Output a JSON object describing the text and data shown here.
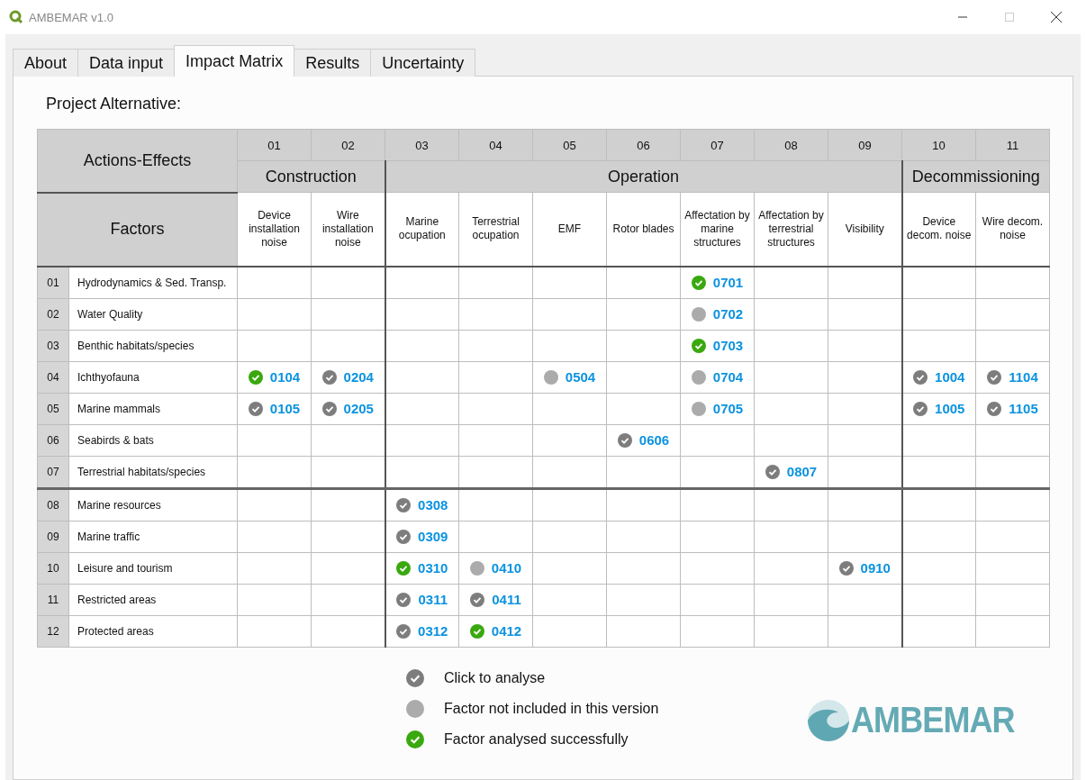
{
  "window": {
    "title": "AMBEMAR v1.0"
  },
  "tabs": [
    {
      "label": "About",
      "selected": false
    },
    {
      "label": "Data input",
      "selected": false
    },
    {
      "label": "Impact Matrix",
      "selected": true
    },
    {
      "label": "Results",
      "selected": false
    },
    {
      "label": "Uncertainty",
      "selected": false
    }
  ],
  "project_label": "Project Alternative:",
  "matrix": {
    "corner_top": "Actions-Effects",
    "corner_bottom": "Factors",
    "groups": [
      {
        "name": "Construction",
        "columns": [
          {
            "num": "01",
            "label": "Device installation noise"
          },
          {
            "num": "02",
            "label": "Wire installation noise"
          }
        ]
      },
      {
        "name": "Operation",
        "columns": [
          {
            "num": "03",
            "label": "Marine ocupation"
          },
          {
            "num": "04",
            "label": "Terrestrial ocupation"
          },
          {
            "num": "05",
            "label": "EMF"
          },
          {
            "num": "06",
            "label": "Rotor blades"
          },
          {
            "num": "07",
            "label": "Affectation by marine structures"
          },
          {
            "num": "08",
            "label": "Affectation by terrestrial structures"
          },
          {
            "num": "09",
            "label": "Visibility"
          }
        ]
      },
      {
        "name": "Decommissioning",
        "columns": [
          {
            "num": "10",
            "label": "Device decom. noise"
          },
          {
            "num": "11",
            "label": "Wire decom. noise"
          }
        ]
      }
    ],
    "row_groups": [
      {
        "rows": [
          {
            "num": "01",
            "name": "Hydrodynamics & Sed. Transp.",
            "cells": [
              {
                "kind": "empty"
              },
              {
                "kind": "empty"
              },
              {
                "kind": "empty"
              },
              {
                "kind": "empty"
              },
              {
                "kind": "empty"
              },
              {
                "kind": "empty"
              },
              {
                "kind": "done",
                "code": "0701"
              },
              {
                "kind": "empty"
              },
              {
                "kind": "empty"
              },
              {
                "kind": "empty"
              },
              {
                "kind": "empty"
              }
            ]
          },
          {
            "num": "02",
            "name": "Water Quality",
            "cells": [
              {
                "kind": "empty"
              },
              {
                "kind": "empty"
              },
              {
                "kind": "empty"
              },
              {
                "kind": "empty"
              },
              {
                "kind": "empty"
              },
              {
                "kind": "empty"
              },
              {
                "kind": "excluded",
                "code": "0702"
              },
              {
                "kind": "empty"
              },
              {
                "kind": "empty"
              },
              {
                "kind": "empty"
              },
              {
                "kind": "empty"
              }
            ]
          },
          {
            "num": "03",
            "name": "Benthic habitats/species",
            "cells": [
              {
                "kind": "empty"
              },
              {
                "kind": "empty"
              },
              {
                "kind": "empty"
              },
              {
                "kind": "empty"
              },
              {
                "kind": "empty"
              },
              {
                "kind": "empty"
              },
              {
                "kind": "done",
                "code": "0703"
              },
              {
                "kind": "empty"
              },
              {
                "kind": "empty"
              },
              {
                "kind": "empty"
              },
              {
                "kind": "empty"
              }
            ]
          },
          {
            "num": "04",
            "name": "Ichthyofauna",
            "cells": [
              {
                "kind": "done",
                "code": "0104"
              },
              {
                "kind": "pending",
                "code": "0204"
              },
              {
                "kind": "empty"
              },
              {
                "kind": "empty"
              },
              {
                "kind": "excluded",
                "code": "0504"
              },
              {
                "kind": "empty"
              },
              {
                "kind": "excluded",
                "code": "0704"
              },
              {
                "kind": "empty"
              },
              {
                "kind": "empty"
              },
              {
                "kind": "pending",
                "code": "1004"
              },
              {
                "kind": "pending",
                "code": "1104"
              }
            ]
          },
          {
            "num": "05",
            "name": "Marine mammals",
            "cells": [
              {
                "kind": "pending",
                "code": "0105"
              },
              {
                "kind": "pending",
                "code": "0205"
              },
              {
                "kind": "empty"
              },
              {
                "kind": "empty"
              },
              {
                "kind": "empty"
              },
              {
                "kind": "empty"
              },
              {
                "kind": "excluded",
                "code": "0705"
              },
              {
                "kind": "empty"
              },
              {
                "kind": "empty"
              },
              {
                "kind": "pending",
                "code": "1005"
              },
              {
                "kind": "pending",
                "code": "1105"
              }
            ]
          },
          {
            "num": "06",
            "name": "Seabirds & bats",
            "cells": [
              {
                "kind": "empty"
              },
              {
                "kind": "empty"
              },
              {
                "kind": "empty"
              },
              {
                "kind": "empty"
              },
              {
                "kind": "empty"
              },
              {
                "kind": "pending",
                "code": "0606"
              },
              {
                "kind": "empty"
              },
              {
                "kind": "empty"
              },
              {
                "kind": "empty"
              },
              {
                "kind": "empty"
              },
              {
                "kind": "empty"
              }
            ]
          },
          {
            "num": "07",
            "name": "Terrestrial habitats/species",
            "cells": [
              {
                "kind": "empty"
              },
              {
                "kind": "empty"
              },
              {
                "kind": "empty"
              },
              {
                "kind": "empty"
              },
              {
                "kind": "empty"
              },
              {
                "kind": "empty"
              },
              {
                "kind": "empty"
              },
              {
                "kind": "pending",
                "code": "0807"
              },
              {
                "kind": "empty"
              },
              {
                "kind": "empty"
              },
              {
                "kind": "empty"
              }
            ]
          }
        ]
      },
      {
        "rows": [
          {
            "num": "08",
            "name": "Marine resources",
            "cells": [
              {
                "kind": "empty"
              },
              {
                "kind": "empty"
              },
              {
                "kind": "pending",
                "code": "0308"
              },
              {
                "kind": "empty"
              },
              {
                "kind": "empty"
              },
              {
                "kind": "empty"
              },
              {
                "kind": "empty"
              },
              {
                "kind": "empty"
              },
              {
                "kind": "empty"
              },
              {
                "kind": "empty"
              },
              {
                "kind": "empty"
              }
            ]
          },
          {
            "num": "09",
            "name": "Marine traffic",
            "cells": [
              {
                "kind": "empty"
              },
              {
                "kind": "empty"
              },
              {
                "kind": "pending",
                "code": "0309"
              },
              {
                "kind": "empty"
              },
              {
                "kind": "empty"
              },
              {
                "kind": "empty"
              },
              {
                "kind": "empty"
              },
              {
                "kind": "empty"
              },
              {
                "kind": "empty"
              },
              {
                "kind": "empty"
              },
              {
                "kind": "empty"
              }
            ]
          },
          {
            "num": "10",
            "name": "Leisure and tourism",
            "cells": [
              {
                "kind": "empty"
              },
              {
                "kind": "empty"
              },
              {
                "kind": "done",
                "code": "0310"
              },
              {
                "kind": "excluded",
                "code": "0410"
              },
              {
                "kind": "empty"
              },
              {
                "kind": "empty"
              },
              {
                "kind": "empty"
              },
              {
                "kind": "empty"
              },
              {
                "kind": "pending",
                "code": "0910"
              },
              {
                "kind": "empty"
              },
              {
                "kind": "empty"
              }
            ]
          },
          {
            "num": "11",
            "name": "Restricted areas",
            "cells": [
              {
                "kind": "empty"
              },
              {
                "kind": "empty"
              },
              {
                "kind": "pending",
                "code": "0311"
              },
              {
                "kind": "pending",
                "code": "0411"
              },
              {
                "kind": "empty"
              },
              {
                "kind": "empty"
              },
              {
                "kind": "empty"
              },
              {
                "kind": "empty"
              },
              {
                "kind": "empty"
              },
              {
                "kind": "empty"
              },
              {
                "kind": "empty"
              }
            ]
          },
          {
            "num": "12",
            "name": "Protected areas",
            "cells": [
              {
                "kind": "empty"
              },
              {
                "kind": "empty"
              },
              {
                "kind": "pending",
                "code": "0312"
              },
              {
                "kind": "done",
                "code": "0412"
              },
              {
                "kind": "empty"
              },
              {
                "kind": "empty"
              },
              {
                "kind": "empty"
              },
              {
                "kind": "empty"
              },
              {
                "kind": "empty"
              },
              {
                "kind": "empty"
              },
              {
                "kind": "empty"
              }
            ]
          }
        ]
      }
    ]
  },
  "legend": [
    {
      "kind": "pending",
      "text": "Click to analyse"
    },
    {
      "kind": "excluded",
      "text": "Factor not included in this version"
    },
    {
      "kind": "done",
      "text": "Factor analysed successfully"
    }
  ],
  "logo": {
    "text": "AMBEMAR"
  }
}
